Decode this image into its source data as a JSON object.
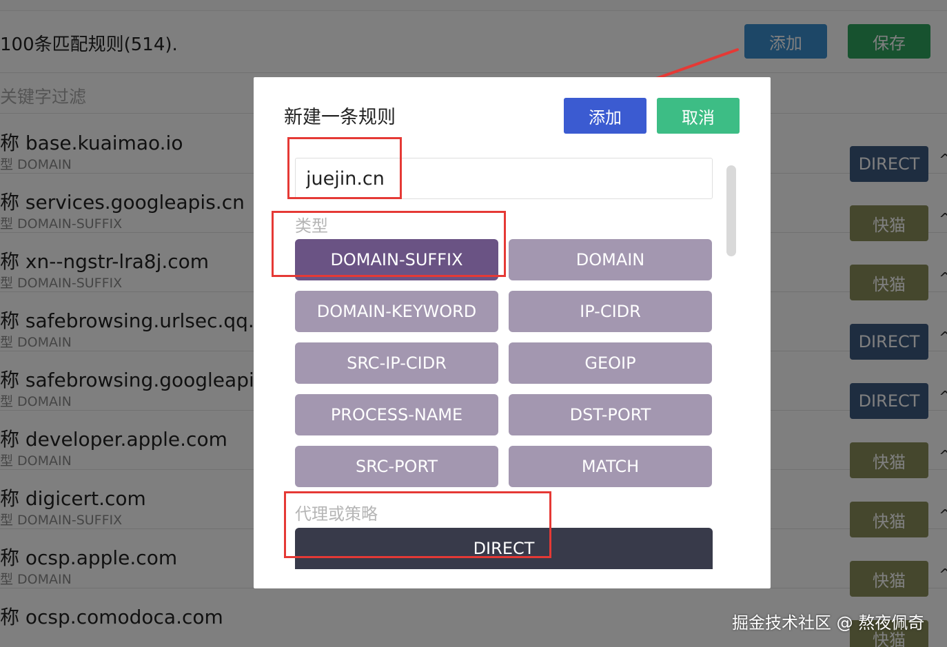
{
  "background": {
    "header": {
      "count_text": "100条匹配规则(514).",
      "add_label": "添加",
      "save_label": "保存"
    },
    "filter_placeholder": "关键字过滤",
    "rules": [
      {
        "name": "称 base.kuaimao.io",
        "type": "型 DOMAIN",
        "policy": "DIRECT",
        "policy_kind": "direct"
      },
      {
        "name": "称 services.googleapis.cn",
        "type": "型 DOMAIN-SUFFIX",
        "policy": "快猫",
        "policy_kind": "kuaimao"
      },
      {
        "name": "称 xn--ngstr-lra8j.com",
        "type": "型 DOMAIN-SUFFIX",
        "policy": "快猫",
        "policy_kind": "kuaimao"
      },
      {
        "name": "称 safebrowsing.urlsec.qq.com",
        "type": "型 DOMAIN",
        "policy": "DIRECT",
        "policy_kind": "direct"
      },
      {
        "name": "称 safebrowsing.googleapis.com",
        "type": "型 DOMAIN",
        "policy": "DIRECT",
        "policy_kind": "direct"
      },
      {
        "name": "称 developer.apple.com",
        "type": "型 DOMAIN",
        "policy": "快猫",
        "policy_kind": "kuaimao"
      },
      {
        "name": "称 digicert.com",
        "type": "型 DOMAIN-SUFFIX",
        "policy": "快猫",
        "policy_kind": "kuaimao"
      },
      {
        "name": "称 ocsp.apple.com",
        "type": "型 DOMAIN",
        "policy": "快猫",
        "policy_kind": "kuaimao"
      },
      {
        "name": "称 ocsp.comodoca.com",
        "type": "",
        "policy": "快猫",
        "policy_kind": "kuaimao"
      }
    ]
  },
  "modal": {
    "title": "新建一条规则",
    "add_label": "添加",
    "cancel_label": "取消",
    "payload_value": "juejin.cn",
    "type_label": "类型",
    "types": [
      "DOMAIN-SUFFIX",
      "DOMAIN",
      "DOMAIN-KEYWORD",
      "IP-CIDR",
      "SRC-IP-CIDR",
      "GEOIP",
      "PROCESS-NAME",
      "DST-PORT",
      "SRC-PORT",
      "MATCH"
    ],
    "selected_type": "DOMAIN-SUFFIX",
    "proxy_label": "代理或策略",
    "proxy_value": "DIRECT"
  },
  "watermark": "掘金技术社区 @ 熬夜佩奇",
  "colors": {
    "annotation_red": "#e53935",
    "modal_add": "#3b5bd1",
    "modal_cancel": "#3dbd85",
    "type_selected": "#6a5384",
    "type_default": "#a397b0",
    "proxy_button": "#383a4a",
    "bg_add": "#3a8fcf",
    "bg_save": "#2ea55e",
    "policy_direct": "#3d5a80",
    "policy_kuaimao": "#8a8f5a"
  }
}
